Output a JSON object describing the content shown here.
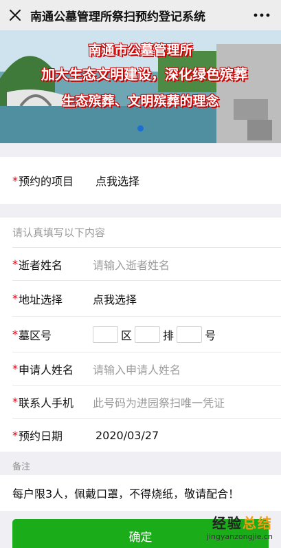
{
  "header": {
    "title": "南通公墓管理所祭扫预约登记系统"
  },
  "banner": {
    "line1": "南通市公墓管理所",
    "line2": "加大生态文明建设，深化绿色殡葬",
    "line3": "生态殡葬、文明殡葬的理念"
  },
  "project": {
    "label": "预约的项目",
    "value": "点我选择"
  },
  "form": {
    "section_title": "请认真填写以下内容",
    "deceased_label": "逝者姓名",
    "deceased_placeholder": "请输入逝者姓名",
    "address_label": "地址选择",
    "address_value": "点我选择",
    "plot_label": "墓区号",
    "plot_area": "区",
    "plot_row": "排",
    "plot_number": "号",
    "applicant_label": "申请人姓名",
    "applicant_placeholder": "请输入申请人姓名",
    "phone_label": "联系人手机",
    "phone_placeholder": "此号码为进园祭扫唯一凭证",
    "date_label": "预约日期",
    "date_value": "2020/03/27"
  },
  "remark": {
    "title": "备注",
    "text": "每户限3人，佩戴口罩，不得烧纸，敬请配合！"
  },
  "confirm_label": "确定",
  "watermark": {
    "brand_a": "经验",
    "brand_b": "总结",
    "domain": "jingyanzongjie.cn"
  },
  "colors": {
    "accent": "#1aad19",
    "required": "#e60012",
    "carousel_dot": "#1b6fd4"
  },
  "icons": {
    "close": "close-icon",
    "more": "more-dots-icon"
  }
}
